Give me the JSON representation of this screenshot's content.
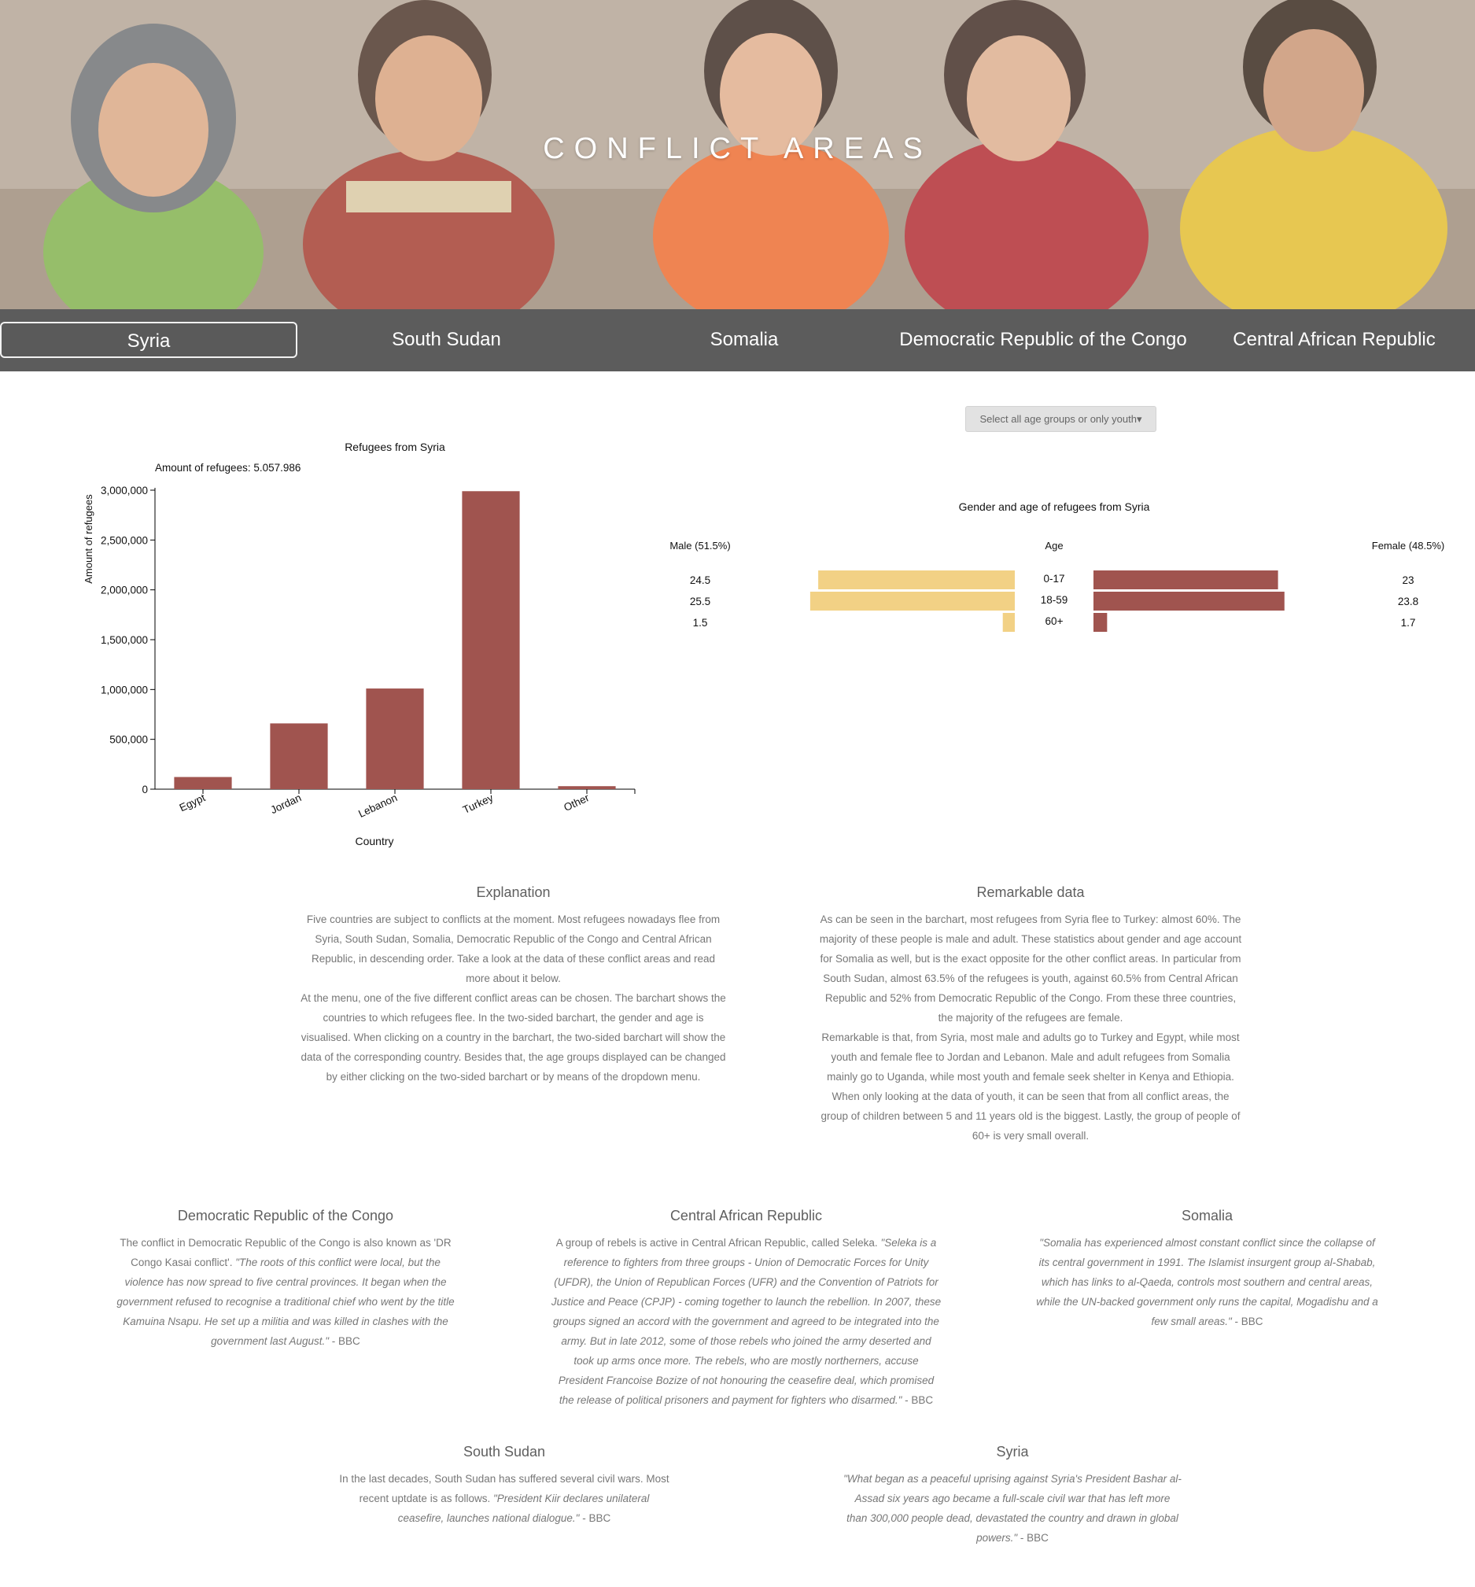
{
  "hero": {
    "title": "CONFLICT AREAS"
  },
  "nav": {
    "items": [
      {
        "label": "Syria",
        "active": true
      },
      {
        "label": "South Sudan",
        "active": false
      },
      {
        "label": "Somalia",
        "active": false
      },
      {
        "label": "Democratic Republic of the Congo",
        "active": false
      },
      {
        "label": "Central African Republic",
        "active": false
      }
    ]
  },
  "dropdown": {
    "label": "Select all age groups or only youth",
    "caret": "▾"
  },
  "colors": {
    "bar": "#a0544f",
    "male": "#f2d185",
    "female": "#a0544f",
    "nav": "#5c5c5c"
  },
  "chart_data": [
    {
      "type": "bar",
      "title": "Refugees from Syria",
      "subtitle": "Amount of refugees: 5.057.986",
      "xlabel": "Country",
      "ylabel": "Amount of refugees",
      "categories": [
        "Egypt",
        "Jordan",
        "Lebanon",
        "Turkey",
        "Other"
      ],
      "values": [
        122000,
        660000,
        1010000,
        2990000,
        30000
      ],
      "ylim": [
        0,
        3000000
      ],
      "yticks": [
        "0",
        "500,000",
        "1,000,000",
        "1,500,000",
        "2,000,000",
        "2,500,000",
        "3,000,000"
      ],
      "grid": false
    },
    {
      "type": "bar",
      "title": "Gender and age of refugees from Syria",
      "left_label": "Male (51.5%)",
      "center_label": "Age",
      "right_label": "Female (48.5%)",
      "categories": [
        "0-17",
        "18-59",
        "60+"
      ],
      "male_values": [
        24.5,
        25.5,
        1.5
      ],
      "female_values": [
        23,
        23.8,
        1.7
      ],
      "male_labels": [
        "24.5",
        "25.5",
        "1.5"
      ],
      "female_labels": [
        "23",
        "23.8",
        "1.7"
      ]
    }
  ],
  "explanation": {
    "title": "Explanation",
    "paragraphs": [
      "Five countries are subject to conflicts at the moment. Most refugees nowadays flee from Syria, South Sudan, Somalia, Democratic Republic of the Congo and Central African Republic, in descending order. Take a look at the data of these conflict areas and read more about it below.",
      "At the menu, one of the five different conflict areas can be chosen. The barchart shows the countries to which refugees flee. In the two-sided barchart, the gender and age is visualised. When clicking on a country in the barchart, the two-sided barchart will show the data of the corresponding country. Besides that, the age groups displayed can be changed by either clicking on the two-sided barchart or by means of the dropdown menu."
    ]
  },
  "remarkable": {
    "title": "Remarkable data",
    "paragraphs": [
      "As can be seen in the barchart, most refugees from Syria flee to Turkey: almost 60%. The majority of these people is male and adult. These statistics about gender and age account for Somalia as well, but is the exact opposite for the other conflict areas. In particular from South Sudan, almost 63.5% of the refugees is youth, against 60.5% from Central African Republic and 52% from Democratic Republic of the Congo. From these three countries, the majority of the refugees are female.",
      "Remarkable is that, from Syria, most male and adults go to Turkey and Egypt, while most youth and female flee to Jordan and Lebanon. Male and adult refugees from Somalia mainly go to Uganda, while most youth and female seek shelter in Kenya and Ethiopia. When only looking at the data of youth, it can be seen that from all conflict areas, the group of children between 5 and 11 years old is the biggest. Lastly, the group of people of 60+ is very small overall."
    ]
  },
  "countries": {
    "drc": {
      "title": "Democratic Republic of the Congo",
      "intro": "The conflict in Democratic Republic of the Congo is also known as 'DR Congo Kasai conflict'.",
      "quote": "\"The roots of this conflict were local, but the violence has now spread to five central provinces. It began when the government refused to recognise a traditional chief who went by the title Kamuina Nsapu. He set up a militia and was killed in clashes with the government last August.\"",
      "source": " - BBC"
    },
    "car": {
      "title": "Central African Republic",
      "intro": "A group of rebels is active in Central African Republic, called Seleka.",
      "quote": "\"Seleka is a reference to fighters from three groups - Union of Democratic Forces for Unity (UFDR), the Union of Republican Forces (UFR) and the Convention of Patriots for Justice and Peace (CPJP) - coming together to launch the rebellion. In 2007, these groups signed an accord with the government and agreed to be integrated into the army. But in late 2012, some of those rebels who joined the army deserted and took up arms once more. The rebels, who are mostly northerners, accuse President Francoise Bozize of not honouring the ceasefire deal, which promised the release of political prisoners and payment for fighters who disarmed.\"",
      "source": " - BBC"
    },
    "somalia": {
      "title": "Somalia",
      "intro": "",
      "quote": "\"Somalia has experienced almost constant conflict since the collapse of its central government in 1991. The Islamist insurgent group al-Shabab, which has links to al-Qaeda, controls most southern and central areas, while the UN-backed government only runs the capital, Mogadishu and a few small areas.\"",
      "source": " - BBC"
    },
    "southsudan": {
      "title": "South Sudan",
      "intro": "In the last decades, South Sudan has suffered several civil wars. Most recent uptdate is as follows.",
      "quote": "\"President Kiir declares unilateral ceasefire, launches national dialogue.\"",
      "source": " - BBC"
    },
    "syria": {
      "title": "Syria",
      "intro": "",
      "quote": "\"What began as a peaceful uprising against Syria's President Bashar al-Assad six years ago became a full-scale civil war that has left more than 300,000 people dead, devastated the country and drawn in global powers.\"",
      "source": " - BBC"
    }
  }
}
